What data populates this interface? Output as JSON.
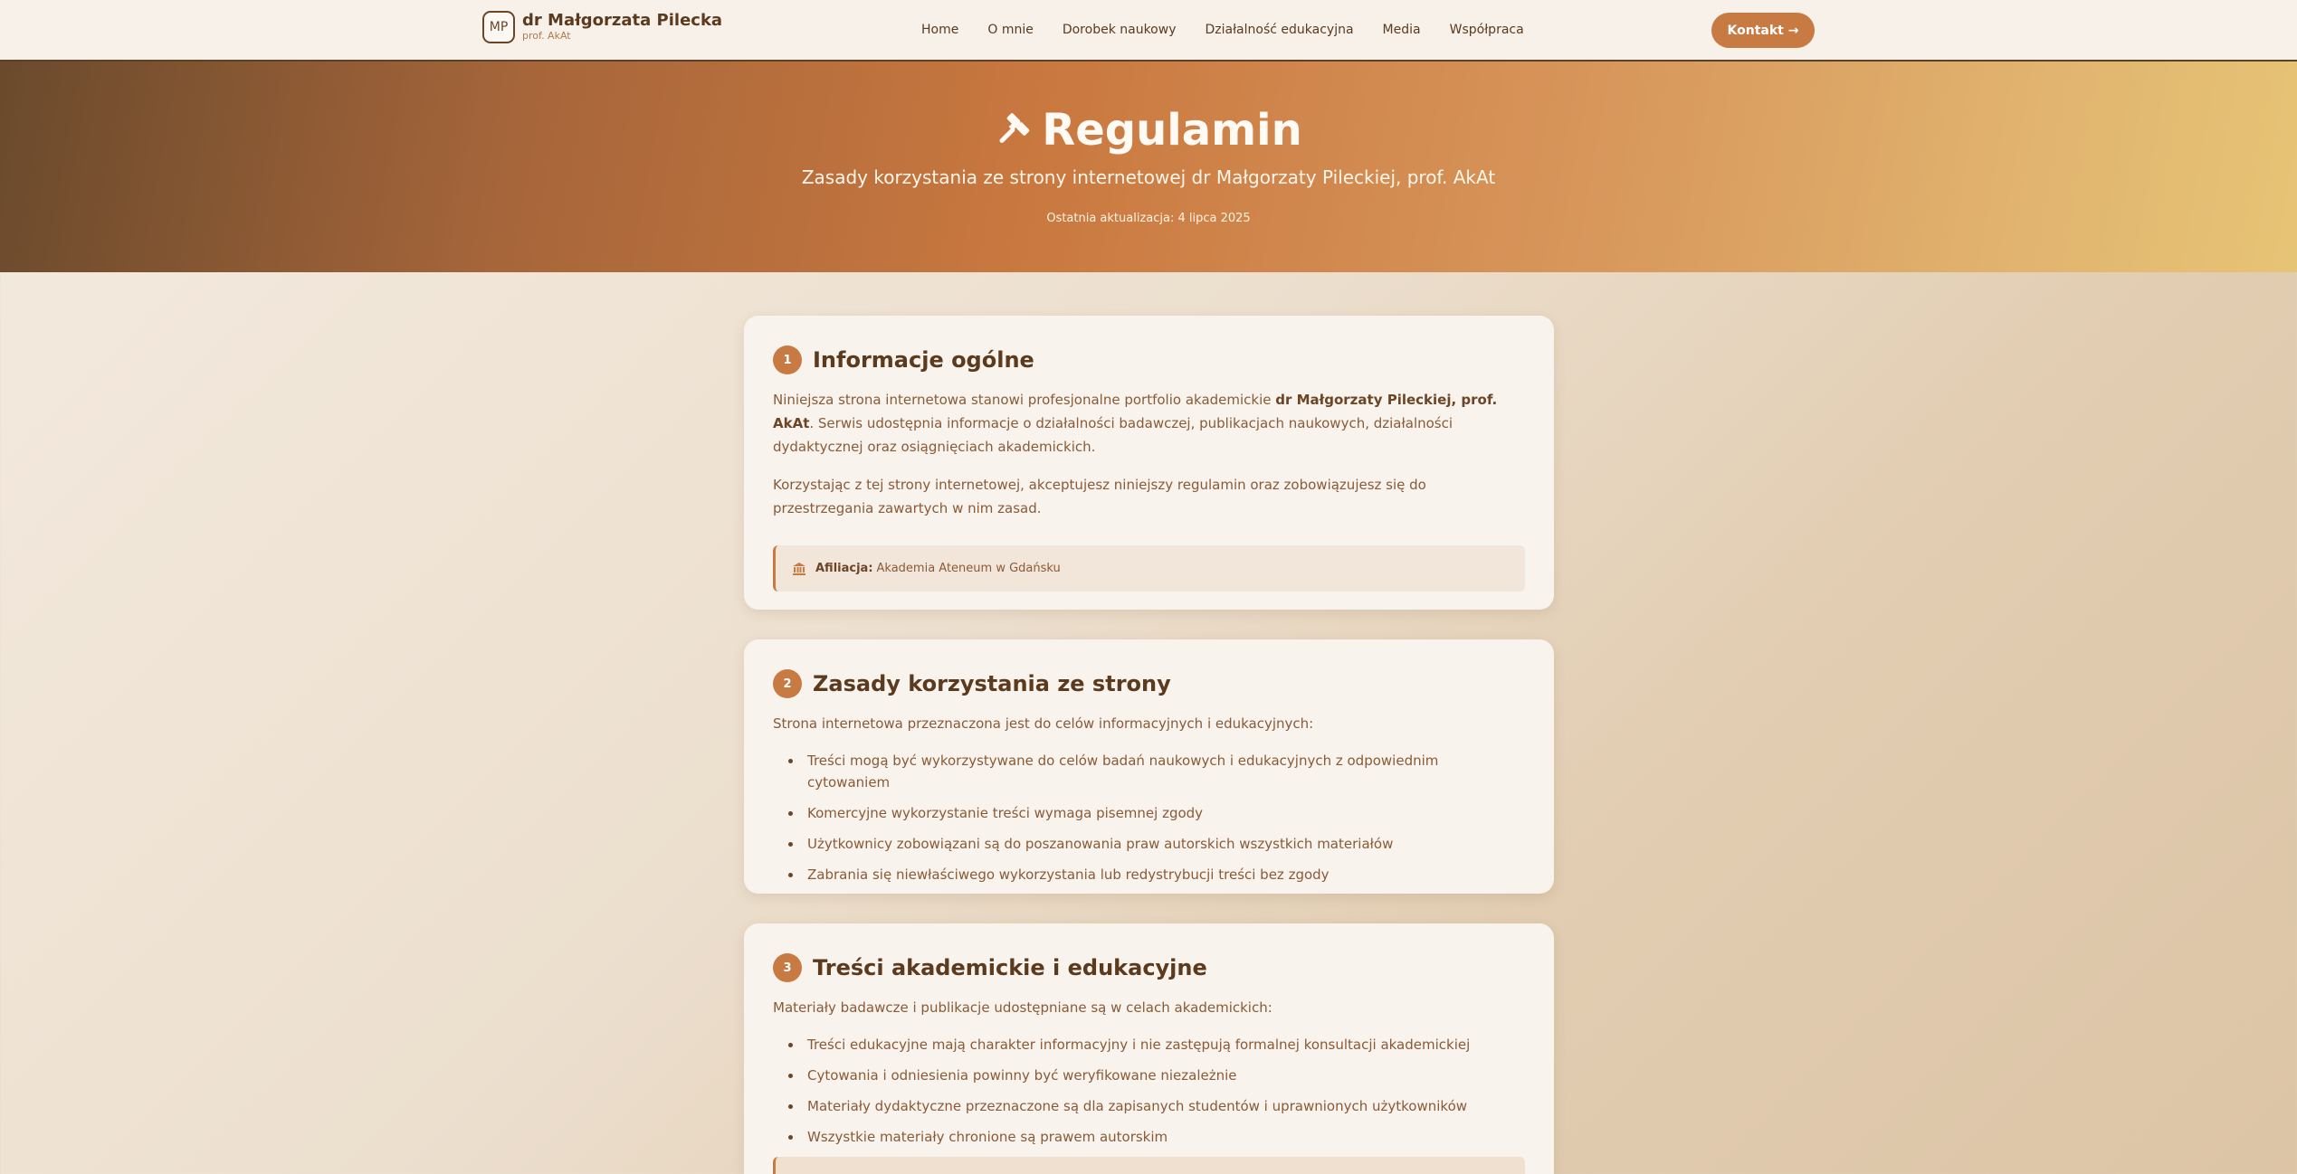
{
  "nav": {
    "logo_initials": "MP",
    "brand_name": "dr Małgorzata Pilecka",
    "brand_sub": "prof. AkAt",
    "links": [
      "Home",
      "O mnie",
      "Dorobek naukowy",
      "Działalność edukacyjna",
      "Media",
      "Współpraca"
    ],
    "contact_label": "Kontakt →"
  },
  "hero": {
    "icon": "gavel-icon",
    "title": "Regulamin",
    "subtitle": "Zasady korzystania ze strony internetowej dr Małgorzaty Pileckiej, prof. AkAt",
    "updated": "Ostatnia aktualizacja: 4 lipca 2025"
  },
  "sections": {
    "s1": {
      "num": "1",
      "title": "Informacje ogólne",
      "p1_pre": "Niniejsza strona internetowa stanowi profesjonalne portfolio akademickie ",
      "p1_bold": "dr Małgorzaty Pileckiej, prof. AkAt",
      "p1_post": ". Serwis udostępnia informacje o działalności badawczej, publikacjach naukowych, działalności dydaktycznej oraz osiągnięciach akademickich.",
      "p2": "Korzystając z tej strony internetowej, akceptujesz niniejszy regulamin oraz zobowiązujesz się do przestrzegania zawartych w nim zasad.",
      "affil_label": "Afiliacja:",
      "affil_value": "Akademia Ateneum w Gdańsku"
    },
    "s2": {
      "num": "2",
      "title": "Zasady korzystania ze strony",
      "intro": "Strona internetowa przeznaczona jest do celów informacyjnych i edukacyjnych:",
      "items": [
        "Treści mogą być wykorzystywane do celów badań naukowych i edukacyjnych z odpowiednim cytowaniem",
        "Komercyjne wykorzystanie treści wymaga pisemnej zgody",
        "Użytkownicy zobowiązani są do poszanowania praw autorskich wszystkich materiałów",
        "Zabrania się niewłaściwego wykorzystania lub redystrybucji treści bez zgody"
      ]
    },
    "s3": {
      "num": "3",
      "title": "Treści akademickie i edukacyjne",
      "intro": "Materiały badawcze i publikacje udostępniane są w celach akademickich:",
      "items": [
        "Treści edukacyjne mają charakter informacyjny i nie zastępują formalnej konsultacji akademickiej",
        "Cytowania i odniesienia powinny być weryfikowane niezależnie",
        "Materiały dydaktyczne przeznaczone są dla zapisanych studentów i uprawnionych użytkowników",
        "Wszystkie materiały chronione są prawem autorskim"
      ]
    }
  }
}
